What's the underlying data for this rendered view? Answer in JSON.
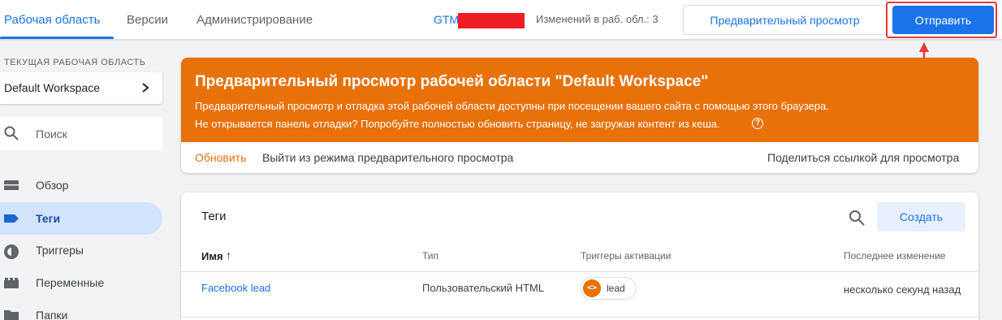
{
  "topbar": {
    "tabs": [
      "Рабочая область",
      "Версии",
      "Администрирование"
    ],
    "container_id": "GTM",
    "changes": "Изменений в раб. обл.: 3",
    "preview_button": "Предварительный просмотр",
    "submit_button": "Отправить",
    "annotation_color": "#e53935"
  },
  "sidebar": {
    "workspace_label": "ТЕКУЩАЯ РАБОЧАЯ ОБЛАСТЬ",
    "workspace_name": "Default Workspace",
    "search_placeholder": "Поиск",
    "items": [
      {
        "label": "Обзор",
        "icon": "folder-icon"
      },
      {
        "label": "Теги",
        "icon": "tag-icon",
        "active": true
      },
      {
        "label": "Триггеры",
        "icon": "trigger-icon"
      },
      {
        "label": "Переменные",
        "icon": "variables-icon"
      },
      {
        "label": "Папки",
        "icon": "folder-icon"
      }
    ]
  },
  "preview_banner": {
    "title": "Предварительный просмотр рабочей области \"Default Workspace\"",
    "line1": "Предварительный просмотр и отладка этой рабочей области доступны при посещении вашего сайта с помощью этого браузера.",
    "line2": "Не открывается панель отладки? Попробуйте полностью обновить страницу, не загружая контент из кеша.",
    "help_icon": "?",
    "actions": {
      "refresh": "Обновить",
      "exit": "Выйти из режима предварительного просмотра",
      "share": "Поделиться ссылкой для просмотра"
    },
    "color": "#e8710a"
  },
  "tags_table": {
    "title": "Теги",
    "create_button": "Создать",
    "columns": [
      "Имя",
      "Тип",
      "Триггеры активации",
      "Последнее изменение"
    ],
    "sort_indicator": "↑",
    "rows": [
      {
        "name": "Facebook lead",
        "type": "Пользовательский HTML",
        "trigger": "lead",
        "trigger_icon": "<>",
        "modified": "несколько секунд назад"
      }
    ]
  }
}
